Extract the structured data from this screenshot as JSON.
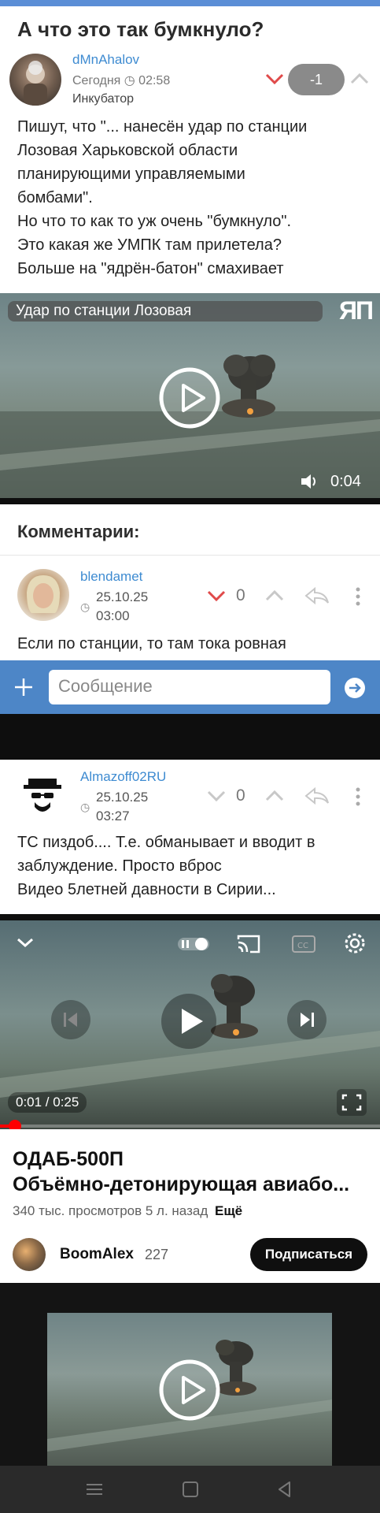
{
  "post": {
    "title": "А что это так бумкнуло?",
    "author": "dMnAhalov",
    "date": "Сегодня ◷ 02:58",
    "section": "Инкубатор",
    "score": "-1",
    "body_lines": [
      "Пишут, что \"... нанесён удар по станции",
      "Лозовая Харьковской области",
      "планирующими управляемыми",
      "бомбами\".",
      "Но что то как то уж очень \"бумкнуло\".",
      "Это какая же УМПК там прилетела?",
      "Больше на \"ядрён-батон\" смахивает"
    ]
  },
  "video1": {
    "label": "Удар по станции Лозовая",
    "logo": "ЯП",
    "duration": "0:04"
  },
  "comments_header": "Комментарии:",
  "comments": [
    {
      "author": "blendamet",
      "date": "25.10.25",
      "time": "03:00",
      "score": "0",
      "text": "Если по станции, то там тока ровная"
    },
    {
      "author": "Almazoff02RU",
      "date": "25.10.25",
      "time": "03:27",
      "score": "0",
      "text_lines": [
        "ТС пиздоб.... Т.е. обманывает и вводит в",
        "заблуждение. Просто вброс",
        "Видео 5летней давности в Сирии..."
      ]
    }
  ],
  "composer": {
    "placeholder": "Сообщение"
  },
  "youtube": {
    "time": "0:01 / 0:25",
    "progress": 0.04,
    "title_line1": "ОДАБ-500П",
    "title_line2": "Объёмно-детонирующая авиабо...",
    "stats": "340 тыс. просмотров  5 л. назад",
    "more": "Ещё",
    "channel": "BoomAlex",
    "subs": "227",
    "subscribe": "Подписаться"
  },
  "colors": {
    "accent": "#3e8bd1",
    "downvote": "#e04a4a",
    "compose_bar": "#4d86c7"
  }
}
